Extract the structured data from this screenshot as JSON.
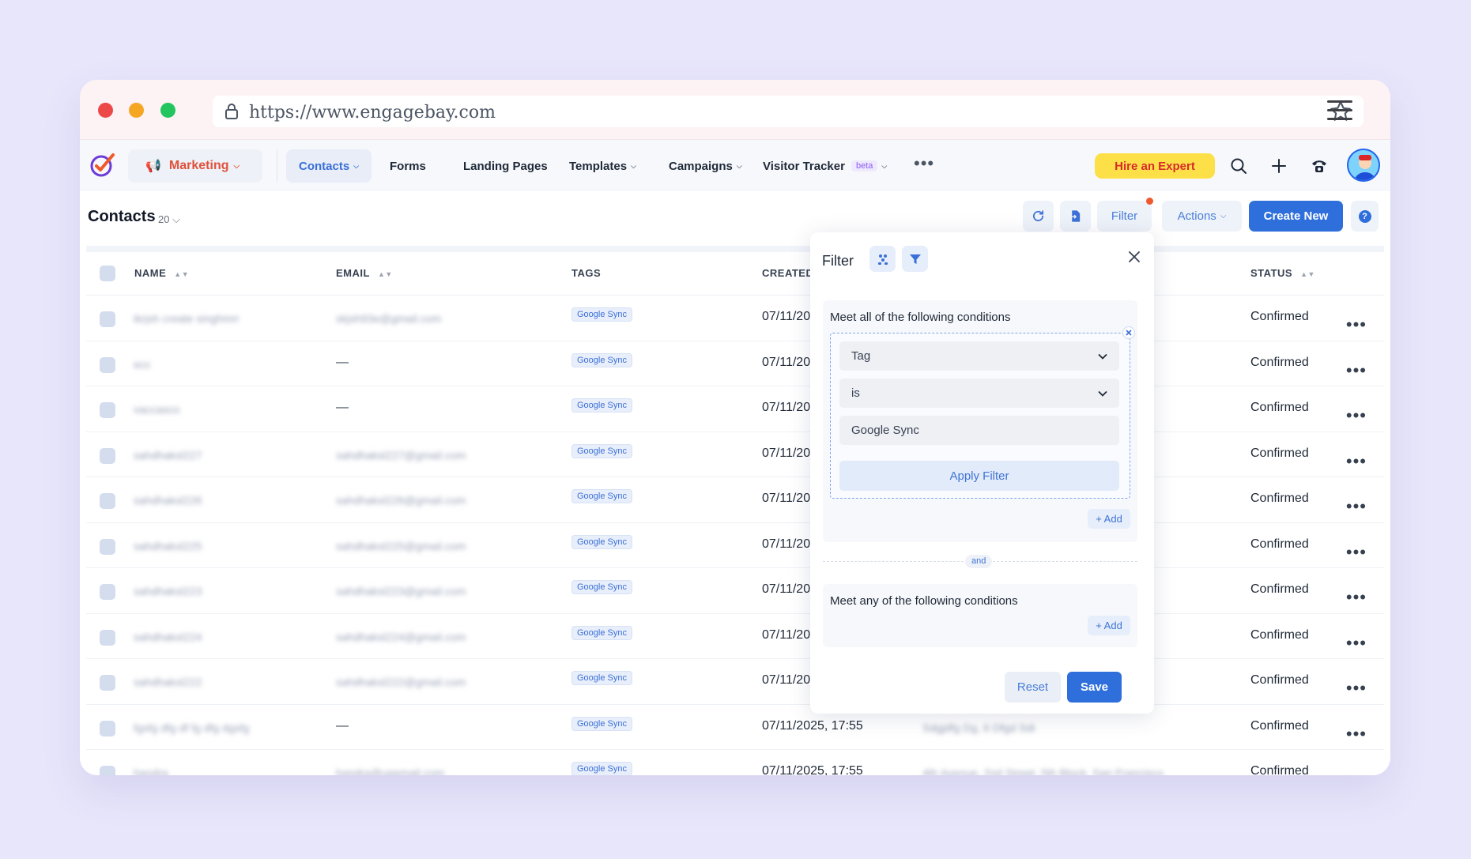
{
  "browser": {
    "url": "https://www.engagebay.com"
  },
  "nav": {
    "module": "Marketing",
    "items": [
      {
        "label": "Contacts",
        "active": true,
        "dropdown": true
      },
      {
        "label": "Forms",
        "active": false,
        "dropdown": false
      },
      {
        "label": "Landing Pages",
        "active": false,
        "dropdown": false
      },
      {
        "label": "Templates",
        "active": false,
        "dropdown": true
      },
      {
        "label": "Campaigns",
        "active": false,
        "dropdown": true
      },
      {
        "label": "Visitor Tracker",
        "active": false,
        "dropdown": true,
        "badge": "beta"
      }
    ],
    "hire_expert": "Hire an Expert"
  },
  "page": {
    "title": "Contacts",
    "count": "20",
    "filter_label": "Filter",
    "actions_label": "Actions",
    "create_label": "Create New",
    "help": "?"
  },
  "table": {
    "headers": {
      "name": "NAME",
      "email": "EMAIL",
      "tags": "TAGS",
      "created": "CREATED",
      "status": "STATUS"
    },
    "rows": [
      {
        "name": "ikrjsh create singhmrr",
        "email": "skjsh93e@gmail.com",
        "tag": "Google Sync",
        "created": "07/11/20",
        "address": "",
        "status": "Confirmed"
      },
      {
        "name": "ecc",
        "email": "—",
        "tag": "Google Sync",
        "created": "07/11/20",
        "address": "",
        "status": "Confirmed"
      },
      {
        "name": "vaccasco",
        "email": "—",
        "tag": "Google Sync",
        "created": "07/11/20",
        "address": "",
        "status": "Confirmed"
      },
      {
        "name": "sahdhaksl227",
        "email": "sahdhaksl227@gmail.com",
        "tag": "Google Sync",
        "created": "07/11/20",
        "address": "",
        "status": "Confirmed"
      },
      {
        "name": "sahdhaksl226",
        "email": "sahdhaksl226@gmail.com",
        "tag": "Google Sync",
        "created": "07/11/20",
        "address": "",
        "status": "Confirmed"
      },
      {
        "name": "sahdhaksl225",
        "email": "sahdhaksl225@gmail.com",
        "tag": "Google Sync",
        "created": "07/11/20",
        "address": "",
        "status": "Confirmed"
      },
      {
        "name": "sahdhaksl223",
        "email": "sahdhaksl223@gmail.com",
        "tag": "Google Sync",
        "created": "07/11/20",
        "address": "",
        "status": "Confirmed"
      },
      {
        "name": "sahdhaksl224",
        "email": "sahdhaksl224@gmail.com",
        "tag": "Google Sync",
        "created": "07/11/20",
        "address": "",
        "status": "Confirmed"
      },
      {
        "name": "sahdhaksl222",
        "email": "sahdhaksl222@gmail.com",
        "tag": "Google Sync",
        "created": "07/11/20",
        "address": "",
        "status": "Confirmed"
      },
      {
        "name": "fgsfg dfg df fg dfg dgsfg",
        "email": "—",
        "tag": "Google Sync",
        "created": "07/11/2025, 17:55",
        "address": "Sdgjdfg Dg, 6 Dfgd Sdi",
        "status": "Confirmed"
      },
      {
        "name": "handra",
        "email": "handra@upemail.com",
        "tag": "Google Sync",
        "created": "07/11/2025, 17:55",
        "address": "4th Avenue, 2nd Street, 5th Block, San Francisco",
        "status": "Confirmed"
      }
    ]
  },
  "filter": {
    "title": "Filter",
    "all_label": "Meet all of the following conditions",
    "field": "Tag",
    "operator": "is",
    "value": "Google Sync",
    "apply_label": "Apply Filter",
    "add_label": "+ Add",
    "and_label": "and",
    "any_label": "Meet any of the following conditions",
    "reset_label": "Reset",
    "save_label": "Save"
  }
}
